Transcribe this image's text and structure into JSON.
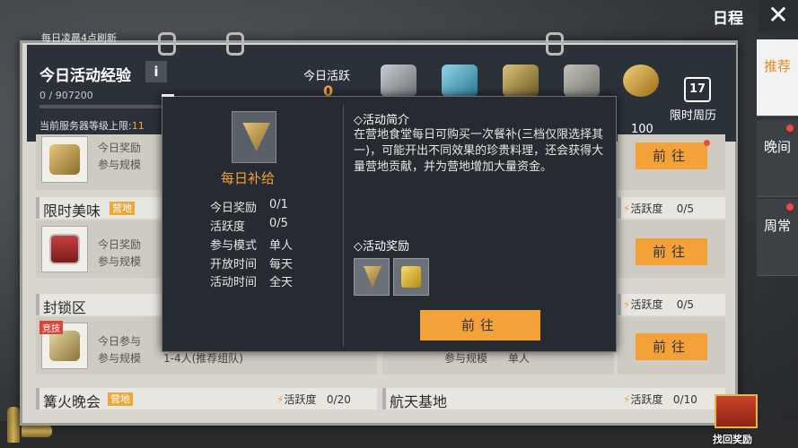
{
  "header": {
    "reset_note": "每日凌晨4点刷新",
    "xp_title": "今日活动经验",
    "info": "i",
    "xp_value": "0 / 907200",
    "server_cap_label": "当前服务器等级上限:",
    "server_cap_value": "11",
    "activity_label": "今日活跃",
    "activity_value": "0",
    "reward_100": "100",
    "calendar_label": "限时周历",
    "calendar_day": "17"
  },
  "topbar": {
    "title": "日程",
    "close": "✕"
  },
  "tabs": [
    {
      "label": "推荐",
      "active": true,
      "dot": false
    },
    {
      "label": "晚间",
      "active": false,
      "dot": true
    },
    {
      "label": "周常",
      "active": false,
      "dot": true
    }
  ],
  "events": {
    "row1": {
      "line1": "今日奖励",
      "line2": "参与规模",
      "go": "前往"
    },
    "row2": {
      "name": "限时美味",
      "tag": "营地",
      "line1": "今日奖励",
      "line2": "参与规模",
      "go": "前往",
      "activity": "活跃度",
      "activity_value": "0/5"
    },
    "row3": {
      "name": "封锁区",
      "badge": "竞技",
      "line1": "今日参与",
      "line2": "参与规模",
      "scale": "1-4人(推荐组队)",
      "go": "前往",
      "activity": "活跃度",
      "activity_value": "0/5",
      "scale2_label": "参与规模",
      "scale2_value": "单人"
    },
    "row4": {
      "name": "篝火晚会",
      "tag": "营地",
      "activity": "活跃度",
      "activity_value": "0/20"
    },
    "row5": {
      "name": "航天基地",
      "activity": "活跃度",
      "activity_value": "0/10"
    },
    "right1": {
      "activity": "活跃度",
      "activity_value": "0/5"
    }
  },
  "popup": {
    "title": "每日补给",
    "stats": [
      {
        "label": "今日奖励",
        "value": "0/1"
      },
      {
        "label": "活跃度",
        "value": "0/5"
      },
      {
        "label": "参与模式",
        "value": "单人"
      },
      {
        "label": "开放时间",
        "value": "每天"
      },
      {
        "label": "活动时间",
        "value": "全天"
      }
    ],
    "intro_title": "◇活动简介",
    "intro_text": "在营地食堂每日可购买一次餐补(三档仅限选择其一)，可能开出不同效果的珍贵料理，还会获得大量营地贡献，并为营地增加大量资金。",
    "reward_title": "◇活动奖励",
    "go": "前往"
  },
  "gift": {
    "label": "找回奖励"
  },
  "colors": {
    "accent": "#f3a23a",
    "alert": "#ef4a3e",
    "panel": "#262b31"
  }
}
